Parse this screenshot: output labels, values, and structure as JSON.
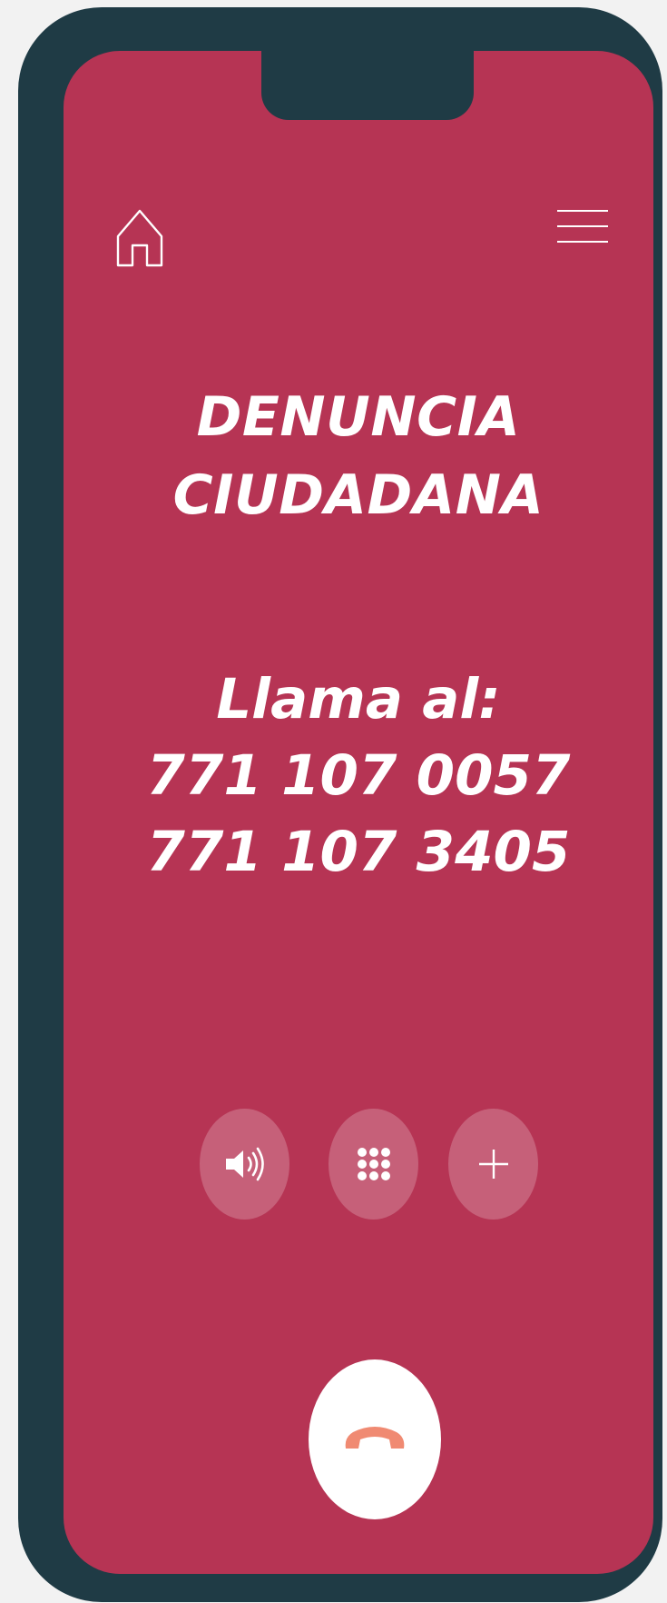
{
  "screen": {
    "title_lines": [
      "DENUNCIA",
      "CIUDADANA"
    ],
    "call_label": "Llama al:",
    "phone_numbers": [
      "771 107 0057",
      "771 107 3405"
    ]
  },
  "icons": {
    "home": "home-icon",
    "menu": "hamburger-menu-icon",
    "speaker": "speaker-icon",
    "keypad": "keypad-icon",
    "add_call": "plus-icon",
    "end_call": "phone-hangup-icon"
  },
  "colors": {
    "frame": "#1f3b45",
    "screen": "#b63454",
    "text": "#ffffff",
    "end_call_handset": "#f08a72"
  }
}
